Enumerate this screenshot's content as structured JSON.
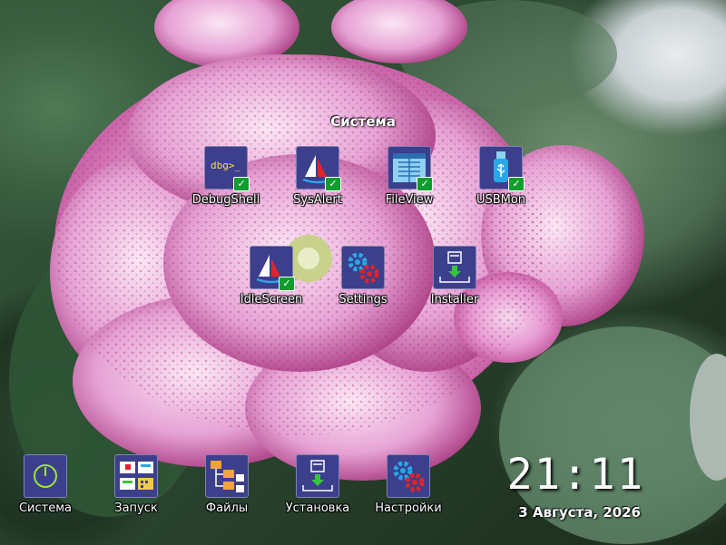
{
  "group": {
    "title": "Система"
  },
  "group_apps": [
    {
      "label": "DebugShell",
      "icon": "debug-shell-icon",
      "installed": true
    },
    {
      "label": "SysAlert",
      "icon": "sailboat-icon",
      "installed": true
    },
    {
      "label": "FileView",
      "icon": "file-view-icon",
      "installed": true
    },
    {
      "label": "USBMon",
      "icon": "usb-icon",
      "installed": true
    },
    {
      "label": "IdleScreen",
      "icon": "sailboat-icon",
      "installed": true
    },
    {
      "label": "Settings",
      "icon": "gears-icon",
      "installed": false
    },
    {
      "label": "Installer",
      "icon": "installer-icon",
      "installed": false
    }
  ],
  "check_mark": "✓",
  "debug_tile_text": "dbg>_",
  "taskbar": [
    {
      "label": "Система",
      "icon": "power-icon"
    },
    {
      "label": "Запуск",
      "icon": "launcher-icon"
    },
    {
      "label": "Файлы",
      "icon": "folders-icon"
    },
    {
      "label": "Установка",
      "icon": "installer-icon"
    },
    {
      "label": "Настройки",
      "icon": "gears-icon"
    }
  ],
  "clock": {
    "time": "21:11",
    "date": "3 Августа, 2026"
  },
  "colors": {
    "tile": "#3c3f8c",
    "check": "#119d2e",
    "gear_blue": "#29a7e8",
    "gear_red": "#e2232a",
    "download_green": "#37c53c"
  }
}
